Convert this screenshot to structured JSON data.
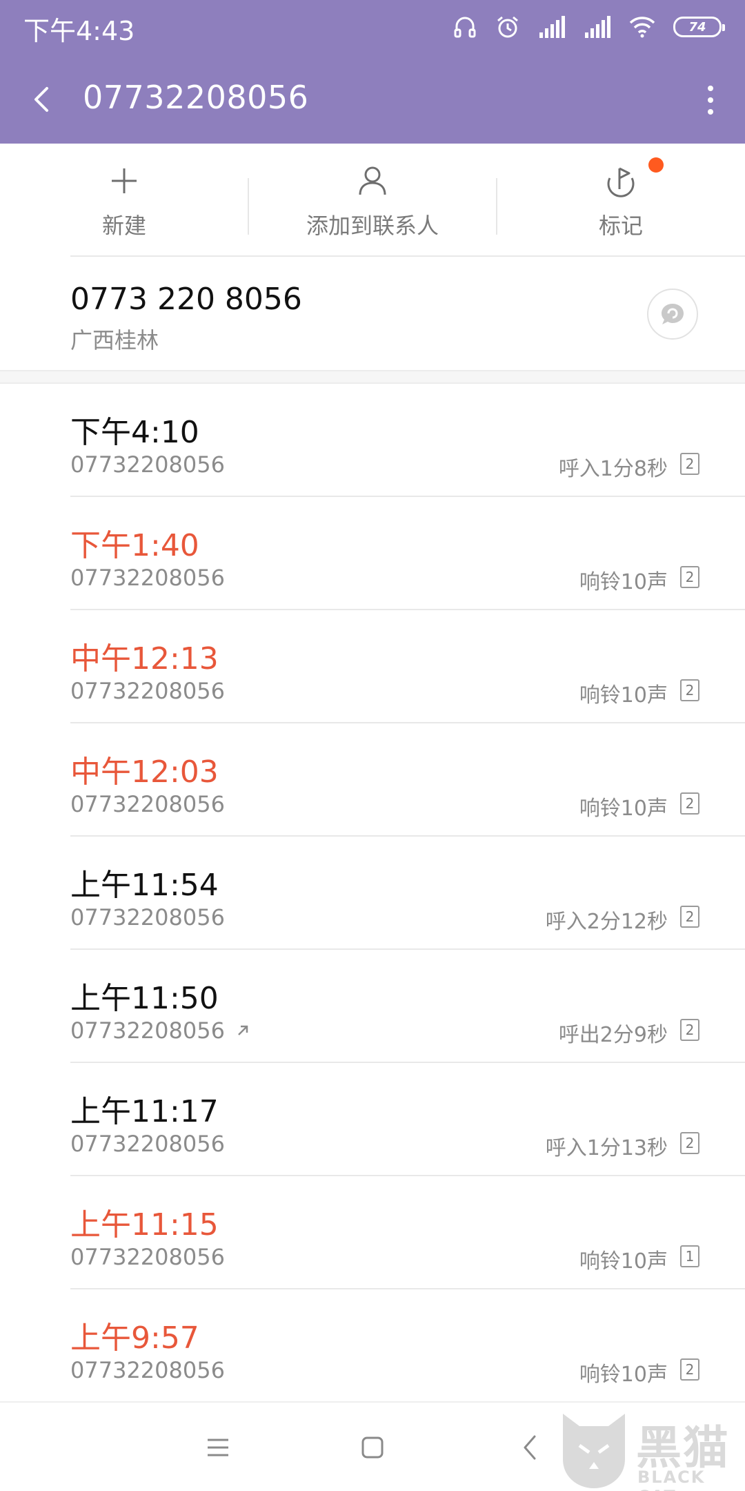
{
  "status_bar": {
    "time": "下午4:43",
    "battery": "74",
    "icons": [
      "headset-icon",
      "alarm-icon",
      "signal-icon",
      "signal-icon",
      "wifi-icon",
      "battery-icon"
    ]
  },
  "header": {
    "title": "07732208056",
    "background": "#8e7fbd"
  },
  "actions": [
    {
      "label": "新建",
      "icon": "plus-icon"
    },
    {
      "label": "添加到联系人",
      "icon": "person-icon"
    },
    {
      "label": "标记",
      "icon": "flag-icon"
    }
  ],
  "contact": {
    "number": "0773 220 8056",
    "location": "广西桂林"
  },
  "calls": [
    {
      "time": "下午4:10",
      "number": "07732208056",
      "info": "呼入1分8秒",
      "sim": "2",
      "missed": false,
      "outgoing": false
    },
    {
      "time": "下午1:40",
      "number": "07732208056",
      "info": "响铃10声",
      "sim": "2",
      "missed": true,
      "outgoing": false
    },
    {
      "time": "中午12:13",
      "number": "07732208056",
      "info": "响铃10声",
      "sim": "2",
      "missed": true,
      "outgoing": false
    },
    {
      "time": "中午12:03",
      "number": "07732208056",
      "info": "响铃10声",
      "sim": "2",
      "missed": true,
      "outgoing": false
    },
    {
      "time": "上午11:54",
      "number": "07732208056",
      "info": "呼入2分12秒",
      "sim": "2",
      "missed": false,
      "outgoing": false
    },
    {
      "time": "上午11:50",
      "number": "07732208056",
      "info": "呼出2分9秒",
      "sim": "2",
      "missed": false,
      "outgoing": true
    },
    {
      "time": "上午11:17",
      "number": "07732208056",
      "info": "呼入1分13秒",
      "sim": "2",
      "missed": false,
      "outgoing": false
    },
    {
      "time": "上午11:15",
      "number": "07732208056",
      "info": "响铃10声",
      "sim": "1",
      "missed": true,
      "outgoing": false
    },
    {
      "time": "上午9:57",
      "number": "07732208056",
      "info": "响铃10声",
      "sim": "2",
      "missed": true,
      "outgoing": false
    }
  ],
  "colors": {
    "missed": "#e8573a",
    "badge_dot": "#ff5a1f"
  },
  "watermark": {
    "text": "黑猫",
    "sub": "BLACK CAT"
  }
}
